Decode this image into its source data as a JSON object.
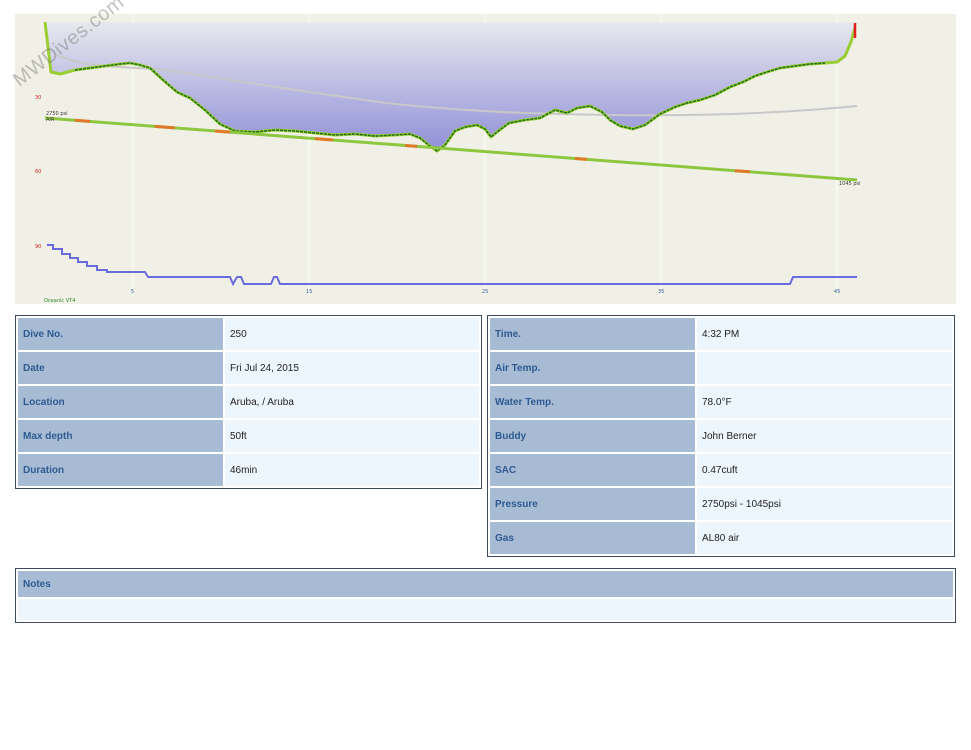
{
  "profile": {
    "watermark": "MWDives.com",
    "depth_scale_labels": [
      "30",
      "60",
      "90"
    ],
    "time_tick_labels": [
      "5",
      "15",
      "25",
      "35",
      "45"
    ],
    "pressure_start_label": "2750 psi",
    "pressure_end_label": "1045 psi",
    "gas_label": "AIR",
    "bottom_left_label": "Oceanic VT4",
    "colors": {
      "depth_fill_top": "#e8e8ee",
      "depth_fill_bottom": "#8f8fd8",
      "depth_line": "#1f6b1f",
      "depth_line_edge": "#9acd32",
      "pressure_line": "#8ec63f",
      "pressure_hot": "#e07a2a",
      "temperature_line": "#6b6be0",
      "ceiling_line": "#c8c8c8",
      "background": "#f1f0e6"
    }
  },
  "dive_info": {
    "rows": [
      {
        "label": "Dive No.",
        "value": "250"
      },
      {
        "label": "Date",
        "value": "Fri Jul 24, 2015"
      },
      {
        "label": "Location",
        "value": "Aruba, / Aruba"
      },
      {
        "label": "Max depth",
        "value": "50ft"
      },
      {
        "label": "Duration",
        "value": "46min"
      }
    ]
  },
  "conditions": {
    "rows": [
      {
        "label": "Time.",
        "value": "4:32 PM"
      },
      {
        "label": "Air Temp.",
        "value": ""
      },
      {
        "label": "Water Temp.",
        "value": "78.0°F"
      },
      {
        "label": "Buddy",
        "value": "John Berner"
      },
      {
        "label": "SAC",
        "value": "0.47cuft"
      },
      {
        "label": "Pressure",
        "value": "2750psi - 1045psi"
      },
      {
        "label": "Gas",
        "value": "AL80 air"
      }
    ]
  },
  "notes": {
    "label": "Notes",
    "value": ""
  }
}
